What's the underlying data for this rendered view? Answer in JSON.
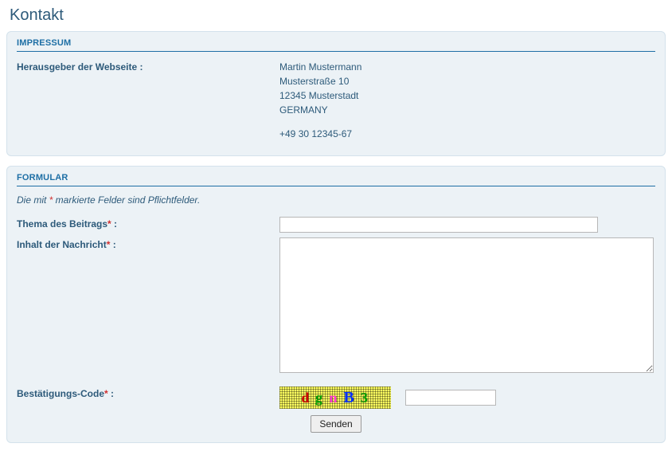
{
  "title": "Kontakt",
  "impressum": {
    "header": "IMPRESSUM",
    "publisher_label": "Herausgeber der Webseite :",
    "name": "Martin Mustermann",
    "street": "Musterstraße 10",
    "city": "12345 Musterstadt",
    "country": "GERMANY",
    "phone": "+49 30 12345-67"
  },
  "form": {
    "header": "FORMULAR",
    "hint_pre": "Die mit ",
    "hint_star": "*",
    "hint_post": " markierte Felder sind Pflichtfelder.",
    "subject_label": "Thema des Beitrags",
    "subject_value": "",
    "message_label": "Inhalt der Nachricht",
    "message_value": "",
    "captcha_label": "Bestätigungs-Code",
    "captcha_chars": {
      "c1": "d",
      "c2": "g",
      "c3": "n",
      "c4": "B",
      "c5": "3"
    },
    "captcha_input_value": "",
    "star": "*",
    "colon": " :",
    "submit_label": "Senden"
  }
}
